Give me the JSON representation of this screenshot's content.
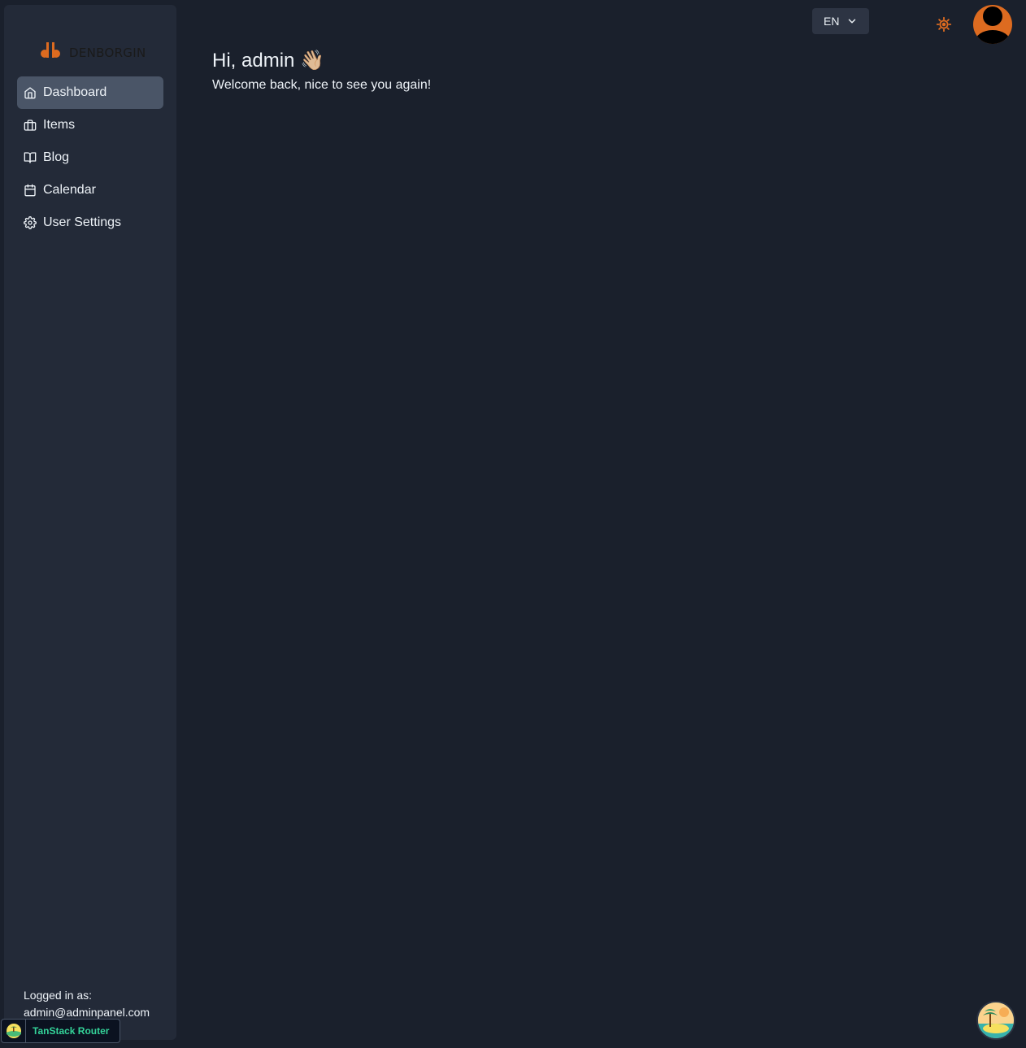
{
  "brand": {
    "name": "DENBORGIN",
    "logo_mark": "db",
    "accent_color": "#dd6b20"
  },
  "sidebar": {
    "items": [
      {
        "label": "Dashboard",
        "icon": "home-icon",
        "active": true
      },
      {
        "label": "Items",
        "icon": "briefcase-icon",
        "active": false
      },
      {
        "label": "Blog",
        "icon": "book-open-icon",
        "active": false
      },
      {
        "label": "Calendar",
        "icon": "calendar-icon",
        "active": false
      },
      {
        "label": "User Settings",
        "icon": "gear-icon",
        "active": false
      }
    ],
    "logged_in_label": "Logged in as:",
    "logged_in_email": "admin@adminpanel.com"
  },
  "header": {
    "language": "EN",
    "theme_icon": "sun-icon",
    "avatar_icon": "user-avatar-icon"
  },
  "main": {
    "greeting": "Hi, admin 👋🏼",
    "subtitle": "Welcome back, nice to see you again!"
  },
  "devtools": {
    "tanstack_label": "TanStack Router",
    "fab_icon": "island-icon"
  }
}
